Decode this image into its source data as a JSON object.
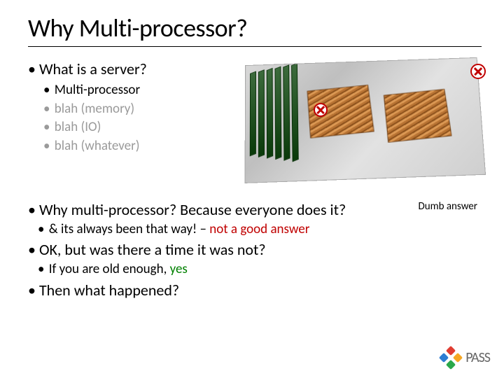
{
  "title": "Why Multi-processor?",
  "q1": "What is a server?",
  "server_items": [
    {
      "text": "Multi-processor",
      "gray": false
    },
    {
      "text": "blah (memory)",
      "gray": true
    },
    {
      "text": "blah (IO)",
      "gray": true
    },
    {
      "text": "blah (whatever)",
      "gray": true
    }
  ],
  "q2": "Why multi-processor? Because everyone does it?",
  "q2_sub_lead": "& its always been that way! – ",
  "q2_sub_bad": "not a good answer",
  "dumb": "Dumb answer",
  "q3": "OK, but was there a time it was not?",
  "q3_sub_lead": "If you are old enough, ",
  "q3_sub_yes": "yes",
  "q4": "Then what happened?",
  "logo_text": "PASS"
}
